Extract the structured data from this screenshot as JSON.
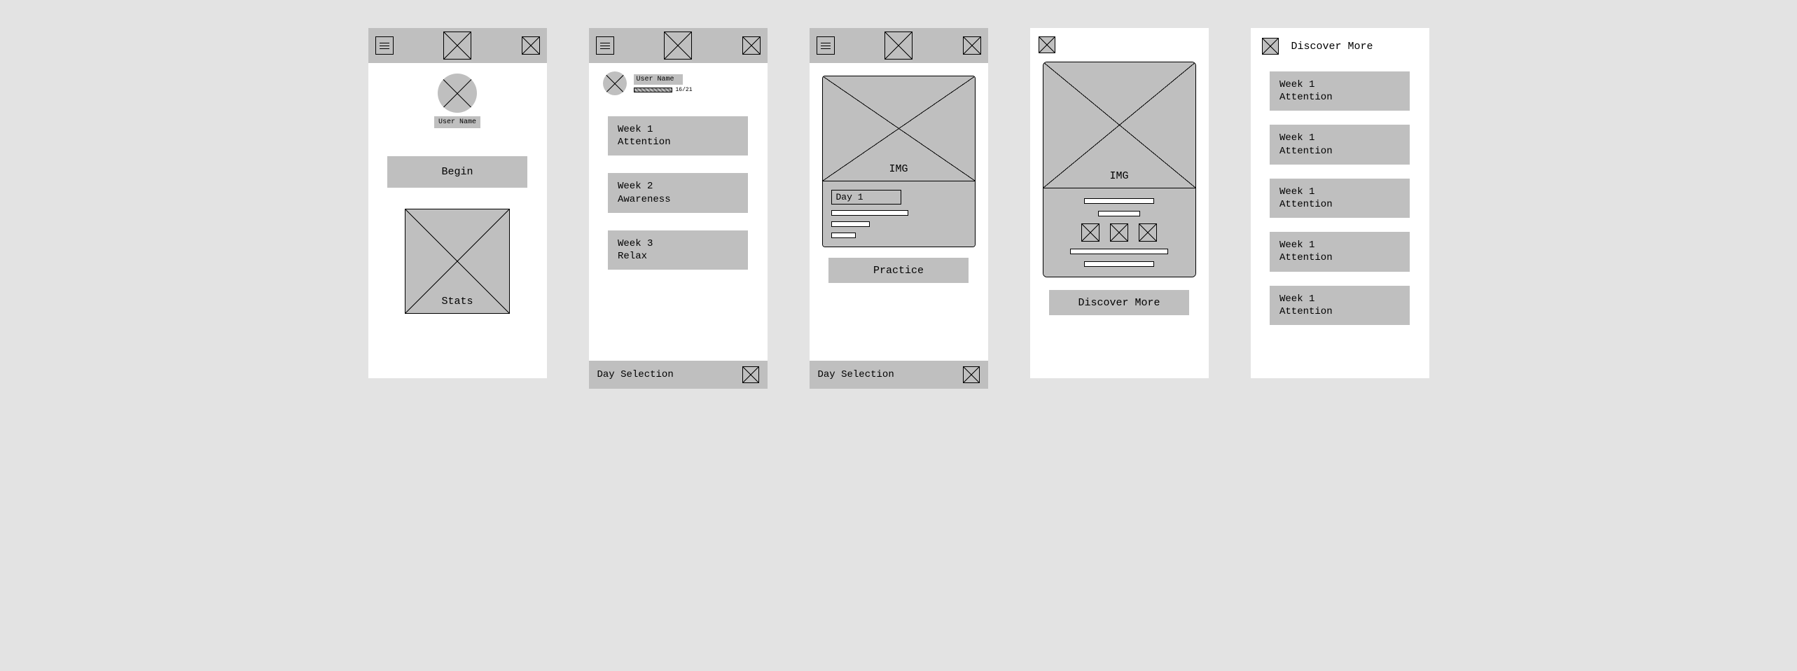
{
  "screen1": {
    "user_name": "User Name",
    "begin": "Begin",
    "stats": "Stats"
  },
  "screen2": {
    "user_name": "User Name",
    "progress": "16/21",
    "weeks": [
      "Week 1\nAttention",
      "Week 2\nAwareness",
      "Week 3\nRelax"
    ],
    "bottom": "Day Selection"
  },
  "screen3": {
    "img": "IMG",
    "day": "Day 1",
    "practice": "Practice",
    "bottom": "Day Selection"
  },
  "screen4": {
    "img": "IMG",
    "discover": "Discover More"
  },
  "screen5": {
    "title": "Discover More",
    "items": [
      "Week 1\nAttention",
      "Week 1\nAttention",
      "Week 1\nAttention",
      "Week 1\nAttention",
      "Week 1\nAttention"
    ]
  }
}
